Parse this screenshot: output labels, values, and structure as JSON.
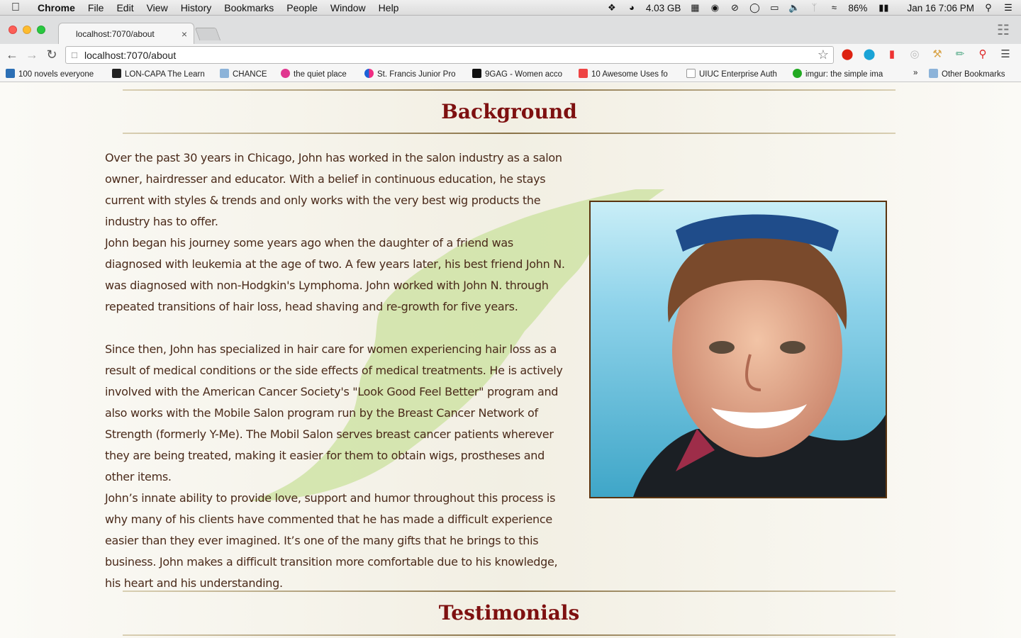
{
  "menubar": {
    "app_name": "Chrome",
    "items": [
      "File",
      "Edit",
      "View",
      "History",
      "Bookmarks",
      "People",
      "Window",
      "Help"
    ],
    "memory": "4.03 GB",
    "battery": "86%",
    "datetime": "Jan 16  7:06 PM"
  },
  "tab": {
    "title": "localhost:7070/about"
  },
  "omnibox": {
    "url": "localhost:7070/about"
  },
  "bookmarks": [
    "100 novels everyone",
    "LON-CAPA The Learn",
    "CHANCE",
    "the quiet place",
    "St. Francis Junior Pro",
    "9GAG - Women acco",
    "10 Awesome Uses fo",
    "UIUC Enterprise Auth",
    "imgur: the simple ima",
    "Other Bookmarks"
  ],
  "content": {
    "background_heading": "Background",
    "paragraphs": [
      "Over the past 30 years in Chicago, John has worked in the salon industry as a salon owner, hairdresser and educator. With a belief in continuous education, he stays current with styles & trends and only works with the very best wig products the industry has to offer.",
      "John began his journey some years ago when the daughter of a friend was diagnosed with leukemia at the age of two. A few years later, his best friend John N. was diagnosed with non-Hodgkin's Lymphoma. John worked with John N. through repeated transitions of hair loss, head shaving and re-growth for five years.",
      "Since then, John has specialized in hair care for women experiencing hair loss as a result of medical conditions or the side effects of medical treatments. He is actively involved with the American Cancer Society's \"Look Good Feel Better\" program and also works with the Mobile Salon program run by the Breast Cancer Network of Strength (formerly Y-Me). The Mobil Salon serves breast cancer patients wherever they are being treated, making it easier for them to obtain wigs, prostheses and other items.",
      "John’s innate ability to provide love, support and humor throughout this process is why many of his clients have commented that he has made a difficult experience easier than they ever imagined. It’s one of the many gifts that he brings to this business. John makes a difficult transition more comfortable due to his knowledge, his heart and his understanding."
    ],
    "testimonials_heading": "Testimonials"
  },
  "colors": {
    "heading": "#7e1010",
    "text": "#4a2a1a",
    "leaf": "#cfe3a6",
    "photo_border": "#5a3410"
  }
}
